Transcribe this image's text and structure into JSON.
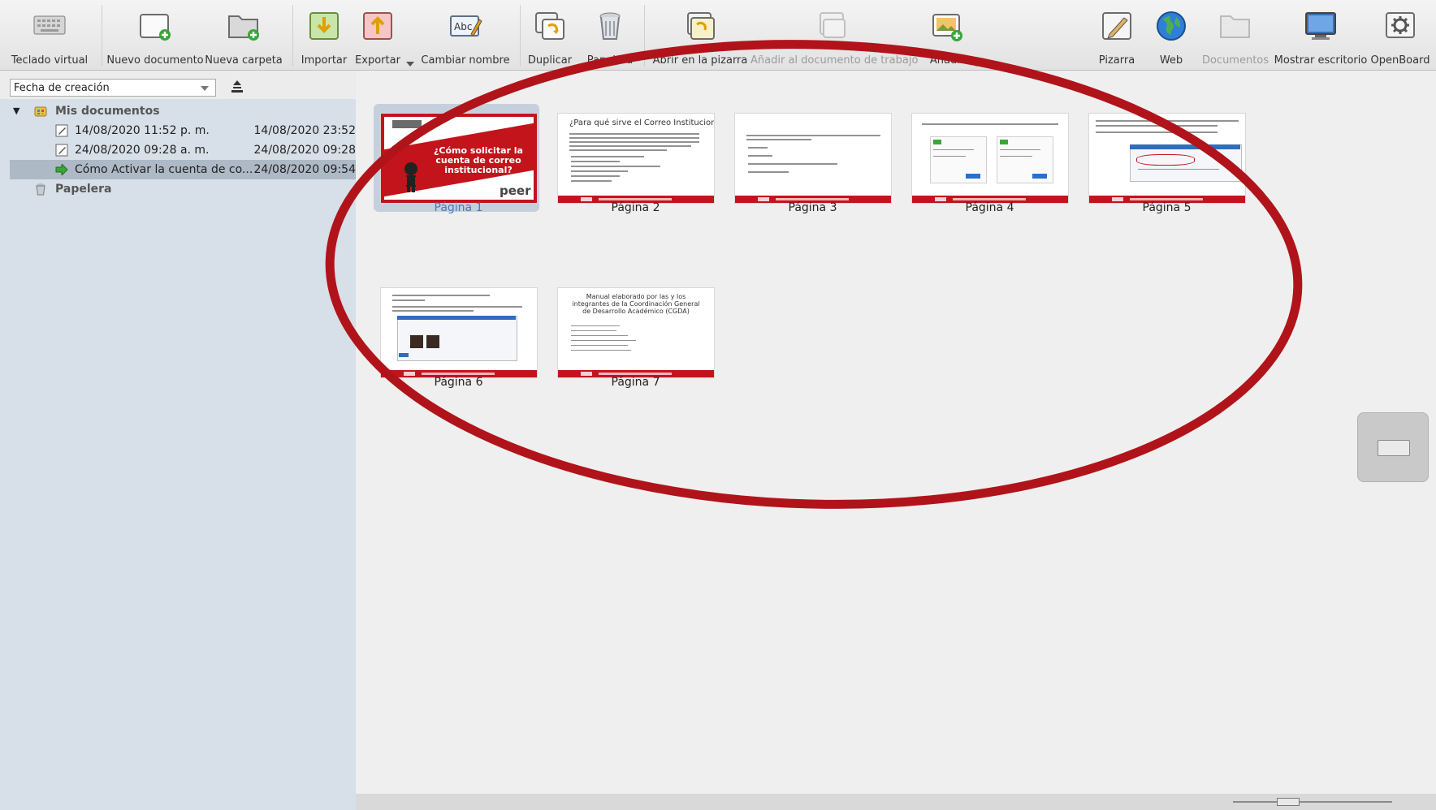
{
  "toolbar": {
    "items": [
      {
        "label": "Teclado virtual",
        "icon": "keyboard-icon"
      },
      {
        "label": "Nuevo documento",
        "icon": "new-document-icon"
      },
      {
        "label": "Nueva carpeta",
        "icon": "new-folder-icon"
      },
      {
        "label": "Importar",
        "icon": "import-icon"
      },
      {
        "label": "Exportar",
        "icon": "export-icon"
      },
      {
        "label": "Cambiar nombre",
        "icon": "rename-icon"
      },
      {
        "label": "Duplicar",
        "icon": "duplicate-icon"
      },
      {
        "label": "Papelera",
        "icon": "trash-icon"
      },
      {
        "label": "Abrir en la pizarra",
        "icon": "open-in-board-icon"
      },
      {
        "label": "Añadir al documento de trabajo",
        "icon": "add-to-document-icon"
      },
      {
        "label": "Añadir",
        "icon": "add-icon"
      },
      {
        "label": "Pizarra",
        "icon": "board-icon"
      },
      {
        "label": "Web",
        "icon": "globe-icon"
      },
      {
        "label": "Documentos",
        "icon": "documents-icon"
      },
      {
        "label": "Mostrar escritorio",
        "icon": "desktop-icon"
      },
      {
        "label": "OpenBoard",
        "icon": "openboard-settings-icon"
      }
    ]
  },
  "sidebar": {
    "sort": {
      "selected": "Fecha de creación"
    },
    "tree": {
      "root_label": "Mis documentos",
      "documents": [
        {
          "name": "14/08/2020 11:52 p. m.",
          "date": "14/08/2020 23:52"
        },
        {
          "name": "24/08/2020 09:28 a. m.",
          "date": "24/08/2020 09:28"
        },
        {
          "name": "Cómo Activar la cuenta de co...",
          "date": "24/08/2020 09:54"
        }
      ],
      "trash_label": "Papelera"
    }
  },
  "pages": [
    {
      "label": "Página 1",
      "title": "¿Cómo solicitar la cuenta de correo institucional?",
      "logo": "peer"
    },
    {
      "label": "Página 2",
      "title": "¿Para qué sirve el Correo Institucional?"
    },
    {
      "label": "Página 3"
    },
    {
      "label": "Página 4"
    },
    {
      "label": "Página 5"
    },
    {
      "label": "Página 6"
    },
    {
      "label": "Página 7",
      "title": "Manual elaborado por las y los integrantes de la Coordinación General de Desarrollo Académico (CGDA)"
    }
  ],
  "colors": {
    "accent": "#c3141c",
    "selection": "#aeb9c6",
    "annotation": "#b0141a",
    "sidebar": "#d7dfe8"
  }
}
